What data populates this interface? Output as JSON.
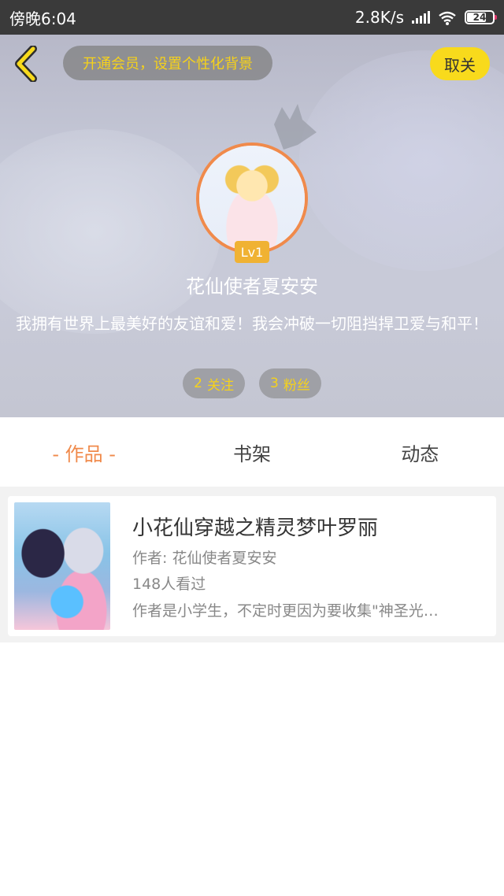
{
  "status_bar": {
    "time": "傍晚6:04",
    "net_speed": "2.8K/s",
    "battery_level": "24"
  },
  "header": {
    "vip_banner": "开通会员，设置个性化背景",
    "follow_button": "取关",
    "level_badge": "Lv1",
    "nickname": "花仙使者夏安安",
    "bio": "我拥有世界上最美好的友谊和爱！我会冲破一切阻挡捍卫爱与和平！",
    "stats": {
      "following_count": "2",
      "following_label": "关注",
      "followers_count": "3",
      "followers_label": "粉丝"
    }
  },
  "tabs": [
    {
      "label": "- 作品 -",
      "active": true
    },
    {
      "label": "书架",
      "active": false
    },
    {
      "label": "动态",
      "active": false
    }
  ],
  "works": [
    {
      "title": "小花仙穿越之精灵梦叶罗丽",
      "author_line": "作者: 花仙使者夏安安",
      "views": "148人看过",
      "description": "作者是小学生，不定时更因为要收集\"神圣光…"
    }
  ],
  "colors": {
    "accent_orange": "#f08a4b",
    "accent_yellow": "#f8da1c",
    "level_badge": "#f0b233",
    "status_bar_bg": "#3a3a3a"
  },
  "icons": [
    "back-chevron-icon",
    "signal-icon",
    "wifi-icon",
    "battery-icon",
    "crown-decoration-icon"
  ]
}
